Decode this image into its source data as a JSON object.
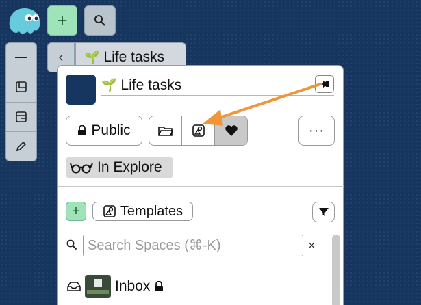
{
  "space": {
    "title": "Life tasks",
    "name_field": "Life tasks"
  },
  "sprout_emoji": "🌱",
  "toolbar": {
    "add_symbol": "+",
    "back_symbol": "‹"
  },
  "panel": {
    "public_label": "Public",
    "more_label": "···",
    "explore_label": "In Explore",
    "templates_label": "Templates",
    "add_template_symbol": "+"
  },
  "search": {
    "placeholder": "Search Spaces (⌘-K)",
    "clear_symbol": "×"
  },
  "list": [
    {
      "label": "Inbox"
    }
  ],
  "colors": {
    "background": "#163660",
    "accent_green": "#9fe3b9",
    "arrow": "#f0963a"
  },
  "icons": [
    "logo-icon",
    "plus-icon",
    "search-icon",
    "minus-icon",
    "card-icon",
    "box-icon",
    "pencil-icon",
    "pin-icon",
    "lock-icon",
    "folder-icon",
    "template-icon",
    "heart-icon",
    "glasses-icon",
    "filter-icon",
    "inbox-tray-icon"
  ]
}
